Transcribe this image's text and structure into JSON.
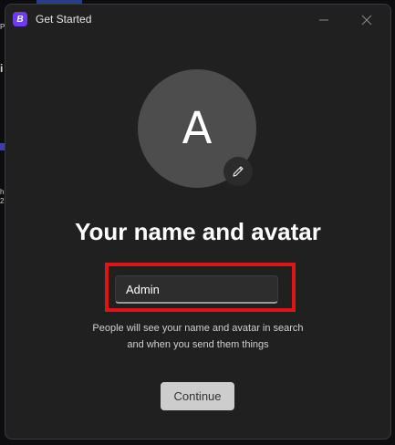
{
  "background": {
    "fragments": [
      "P",
      "i",
      "h",
      "2"
    ]
  },
  "window": {
    "title": "Get Started",
    "app_icon_letter": "B",
    "accent_color": "#6d3cf0",
    "controls": {
      "minimize_icon": "minimize-icon",
      "close_icon": "close-icon"
    }
  },
  "avatar": {
    "initial": "A",
    "edit_icon": "pencil-icon"
  },
  "heading": "Your name and avatar",
  "name_field": {
    "value": "Admin",
    "placeholder": ""
  },
  "helper": {
    "line1": "People will see your name and avatar in search",
    "line2": "and when you send them things"
  },
  "continue_label": "Continue",
  "highlight_color": "#e0121c"
}
